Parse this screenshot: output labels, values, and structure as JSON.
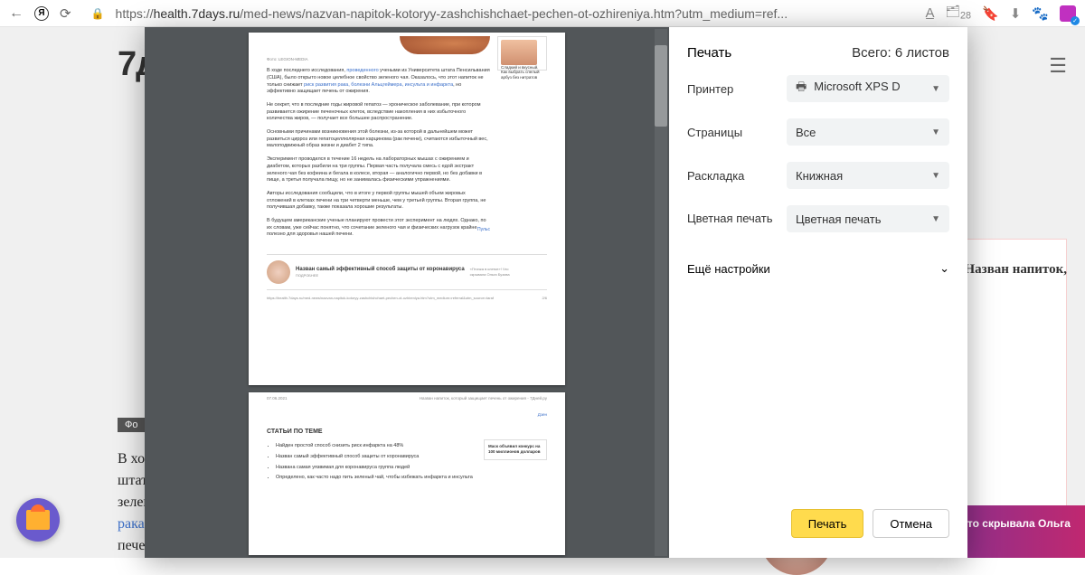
{
  "browser": {
    "url_prefix": "https://",
    "url_host": "health.7days.ru",
    "url_path": "/med-news/nazvan-napitok-kotoryy-zashchishchaet-pechen-ot-ozhireniya.htm?utm_medium=ref...",
    "tab_count": "28"
  },
  "page": {
    "logo": "7дн",
    "photo_caption_prefix": "Фо",
    "article_line1": "В хо",
    "article_rest": "штата Пенсильвания (США), было открыто новое целебное свойство зеленого чая. Оказалось, что этот напиток не только снижает ",
    "link1": "риск развития рака",
    "sep1": ", ",
    "link2": "болезни Альцгеймера",
    "sep2": ", ",
    "link3": "инсульта и инфаркта",
    "article_tail": ", но эффективно защищает печень от ожирения.",
    "side_title": "Назван напиток,",
    "promo": "«Птичка в клетке»! Что скрывала Ольга Бузова"
  },
  "print": {
    "title": "Печать",
    "total": "Всего: 6 листов",
    "labels": {
      "printer": "Принтер",
      "pages": "Страницы",
      "layout": "Раскладка",
      "color": "Цветная печать",
      "more": "Ещё настройки"
    },
    "values": {
      "printer": "Microsoft XPS D",
      "pages": "Все",
      "layout": "Книжная",
      "color": "Цветная печать"
    },
    "buttons": {
      "print": "Печать",
      "cancel": "Отмена"
    }
  },
  "preview": {
    "caption": "Фото: LEGION-MEDIA",
    "side_box": "Сладкий и вкусный. Как выбрать спелый арбуз без нитратов",
    "p1a": "В ходе последнего исследования, ",
    "p1link": "проведенного",
    "p1b": " учеными из Университета штата Пенсильвания (США), было открыто новое целебное свойство зеленого чая. Оказалось, что этот напиток не только снижает ",
    "p1link2": "риск развития рака, болезни Альцгеймера, инсульта и инфаркта",
    "p1c": ", но эффективно защищает печень от ожирения.",
    "p2": "Не секрет, что в последние годы жировой гепатоз — хроническое заболевание, при котором развивается ожирение печеночных клеток, вследствие накопления в них избыточного количества жиров, — получает все большее распространение.",
    "p3": "Основными причинами возникновения этой болезни, из-за которой в дальнейшем может развиться цирроз или гепатоцеллюлярная карцинома (рак печени), считаются избыточный вес, малоподвижный образ жизни и диабет 2 типа.",
    "p4": "Эксперимент проводился в течение 16 недель на лабораторных мышах с ожирением и диабетом, которых разбили на три группы. Первая часть получала смесь с едой экстракт зеленого чая без кофеина и бегала в колесе, вторая — аналогично первой, но без добавки в пище, а третья получала пищу, но не занималась физическими упражнениями.",
    "p5": "Авторы исследования сообщили, что в итоге у первой группы мышей объем жировых отложений в клетках печени на три четверти меньше, чем у третьей группы. Вторая группа, не получившая добавку, также показала хорошие результаты.",
    "p6": "В будущем американские ученые планируют провести этот эксперимент на людях. Однако, по их словам, уже сейчас понятно, что сочетание зеленого чая и физических нагрузок крайне полезно для здоровья нашей печени.",
    "pulse": "Пульс",
    "promo_title": "Назван самый эффективный способ защиты от коронавируса",
    "promo_sub": "ПОДРОБНЕЕ",
    "promo_right": "«Птичка в клетке»! Что скрывала Ольга Бузова",
    "page_url": "https://health.7days.ru/med-news/nazvan-napitok-kotoryy-zashchishchaet-pechen-ot-ozhireniya.htm?utm_medium=referral&utm_source=taraf",
    "page_num1": "2/6",
    "p2_date": "07.06.2021",
    "p2_title": "Назван напиток, который защищает печень от ожирения - 7Дней.ру",
    "p2_zen": "Дзен",
    "section": "СТАТЬИ ПО ТЕМЕ",
    "bullets": [
      "Найден простой способ снизить риск инфаркта на 48%",
      "Назван самый эффективный способ защиты от коронавируса",
      "Названа самая уязвимая для коронавируса группа людей",
      "Определено, как часто надо пить зеленый чай, чтобы избежать инфаркта и инсульта"
    ],
    "p2_side": "Маск объявил конкурс на 100 миллионов долларов"
  }
}
